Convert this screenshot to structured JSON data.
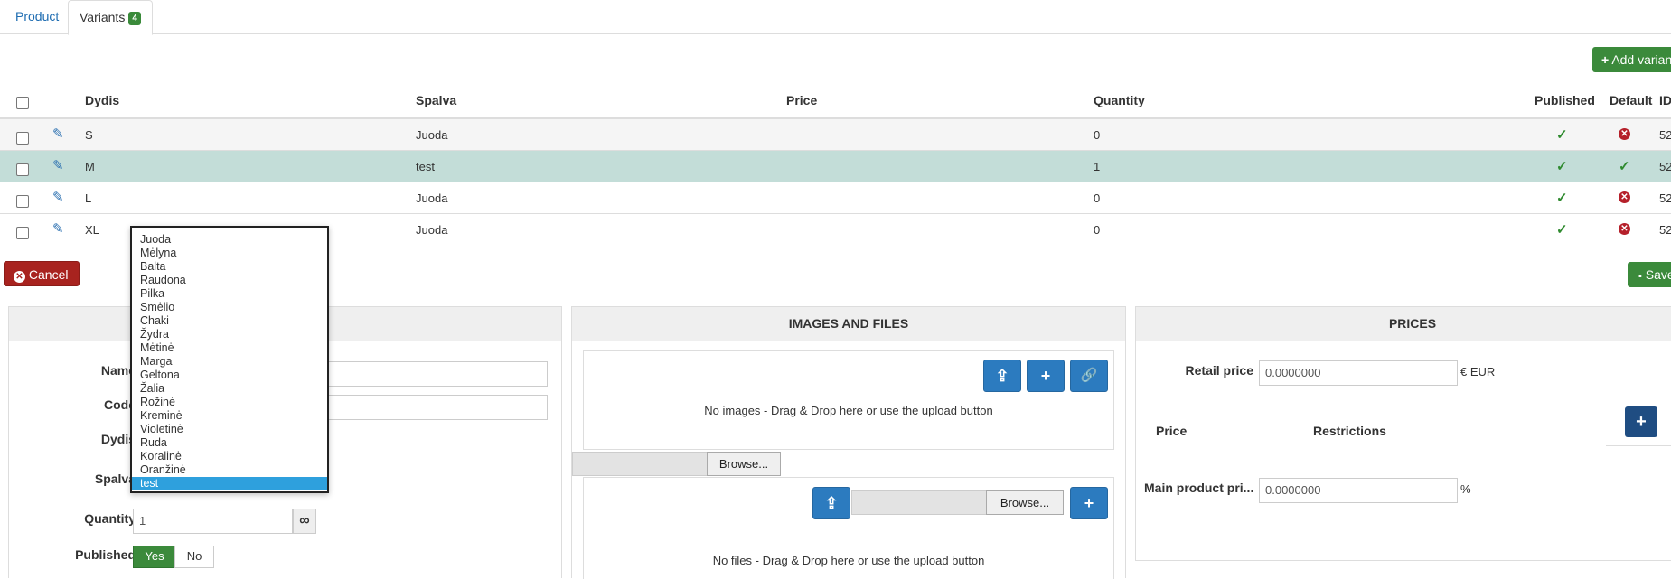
{
  "tabs": [
    {
      "label": "Product"
    },
    {
      "label": "Variants",
      "badge": "4"
    }
  ],
  "toolbar": {
    "add_variant": "Add variant",
    "cancel": "Cancel",
    "save": "Save"
  },
  "table": {
    "headers": {
      "size": "Dydis",
      "color": "Spalva",
      "price": "Price",
      "quantity": "Quantity",
      "published": "Published",
      "default": "Default",
      "id": "ID"
    },
    "rows": [
      {
        "size": "S",
        "color": "Juoda",
        "price": "",
        "quantity": "0",
        "published": true,
        "default": false,
        "id": "52"
      },
      {
        "size": "M",
        "color": "test",
        "price": "",
        "quantity": "1",
        "published": true,
        "default": true,
        "id": "52"
      },
      {
        "size": "L",
        "color": "Juoda",
        "price": "",
        "quantity": "0",
        "published": true,
        "default": false,
        "id": "52"
      },
      {
        "size": "XL",
        "color": "Juoda",
        "price": "",
        "quantity": "0",
        "published": true,
        "default": false,
        "id": "52"
      }
    ]
  },
  "form": {
    "name_label": "Name",
    "code_label": "Code",
    "size_label": "Dydis",
    "color_label": "Spalva",
    "quantity_label": "Quantity",
    "quantity_value": "1",
    "published_label": "Published",
    "yes": "Yes",
    "no": "No"
  },
  "color_options": [
    "Juoda",
    "Mėlyna",
    "Balta",
    "Raudona",
    "Pilka",
    "Smėlio",
    "Chaki",
    "Žydra",
    "Mėtinė",
    "Marga",
    "Geltona",
    "Žalia",
    "Rožinė",
    "Kreminė",
    "Violetinė",
    "Ruda",
    "Koralinė",
    "Oranžinė",
    "test"
  ],
  "color_selected": "test",
  "images": {
    "title": "IMAGES AND FILES",
    "no_images": "No images - Drag & Drop here or use the upload button",
    "no_files": "No files - Drag & Drop here or use the upload button",
    "browse": "Browse..."
  },
  "prices": {
    "title": "PRICES",
    "retail_label": "Retail price",
    "retail_value": "0.0000000",
    "currency": "€ EUR",
    "col_price": "Price",
    "col_restrictions": "Restrictions",
    "main_label": "Main product pri...",
    "main_value": "0.0000000",
    "percent": "%"
  }
}
